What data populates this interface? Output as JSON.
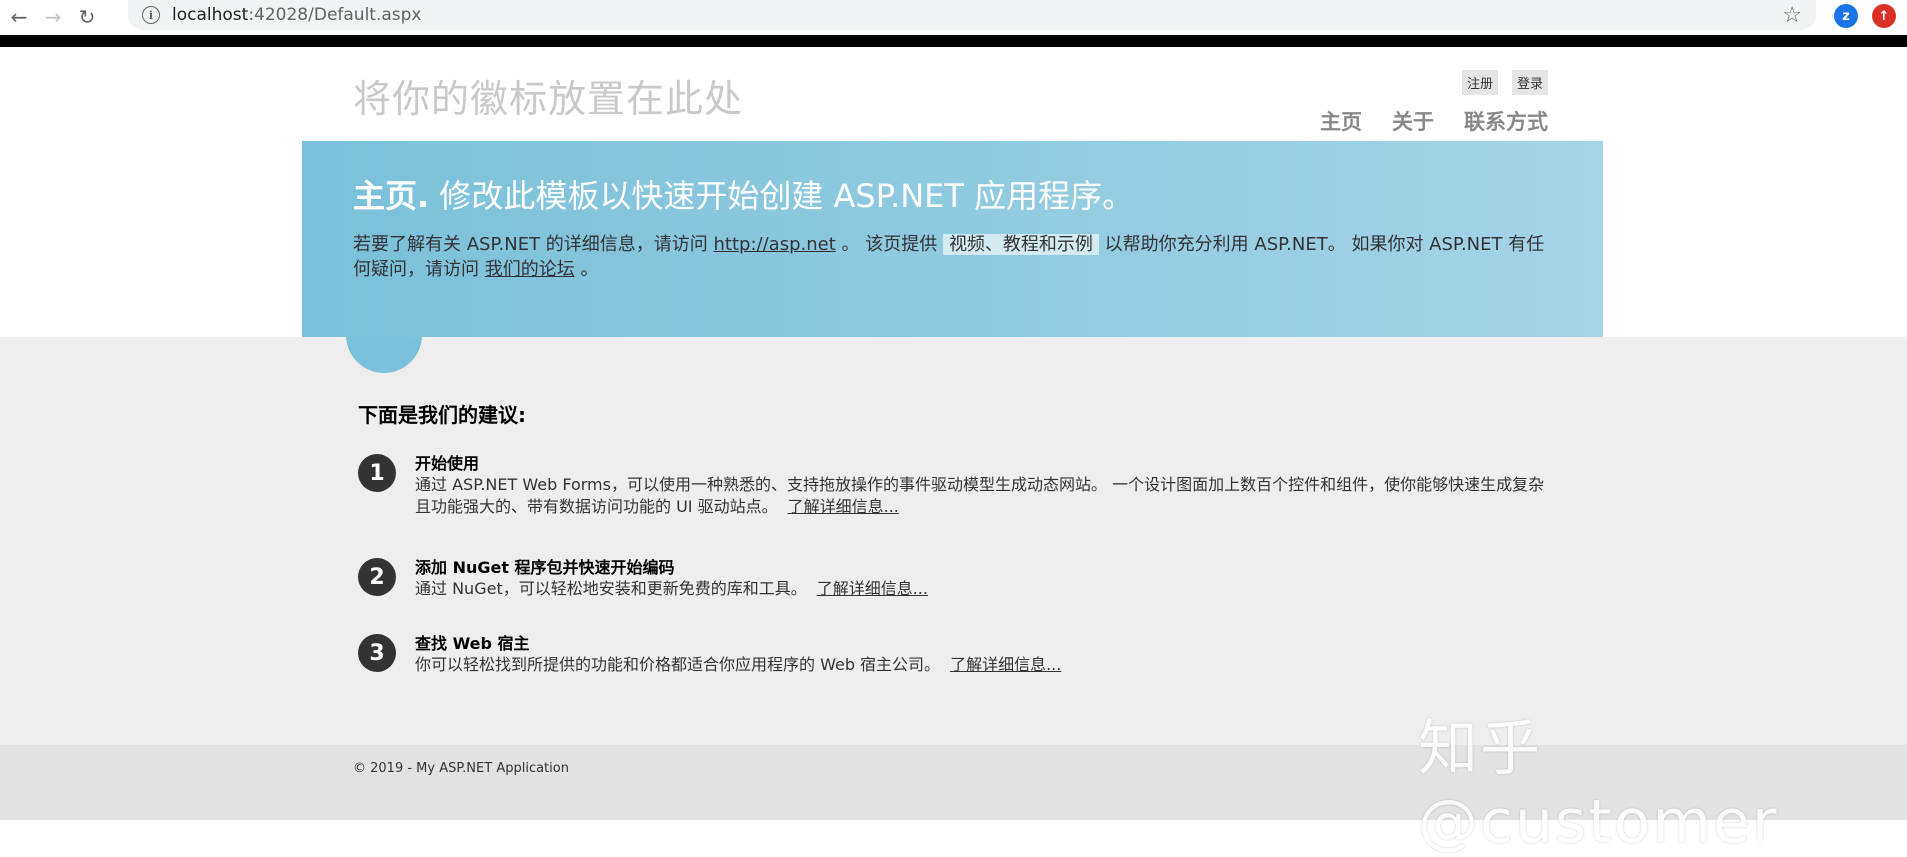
{
  "browser": {
    "back_icon": "arrow-left",
    "forward_icon": "arrow-right",
    "reload_icon": "reload",
    "url_host": "localhost",
    "url_rest": ":42028/Default.aspx",
    "ext1_label": "z",
    "ext2_label": "↑",
    "colors": {
      "ext1": "#1a73e8",
      "ext2": "#d93025"
    }
  },
  "header": {
    "site_title": "将你的徽标放置在此处",
    "register_label": "注册",
    "login_label": "登录",
    "menu": [
      "主页",
      "关于",
      "联系方式"
    ]
  },
  "featured": {
    "heading_strong": "主页.",
    "heading_rest": " 修改此模板以快速开始创建 ASP.NET 应用程序。",
    "text_1": "若要了解有关 ASP.NET 的详细信息，请访问 ",
    "link_1": "http://asp.net",
    "text_2": " 。 该页提供 ",
    "link_2": "视频、教程和示例",
    "text_3": " 以帮助你充分利用 ASP.NET。 如果你对 ASP.NET 有任何疑问，请访问 ",
    "link_3": "我们的论坛",
    "text_4": " 。"
  },
  "body": {
    "recommend_title": "下面是我们的建议:",
    "items": [
      {
        "num": "1",
        "title": "开始使用",
        "text": "通过 ASP.NET Web Forms，可以使用一种熟悉的、支持拖放操作的事件驱动模型生成动态网站。 一个设计图面加上数百个控件和组件，使你能够快速生成复杂且功能强大的、带有数据访问功能的 UI 驱动站点。",
        "link": "了解详细信息..."
      },
      {
        "num": "2",
        "title": "添加 NuGet 程序包并快速开始编码",
        "text": "通过 NuGet，可以轻松地安装和更新免费的库和工具。",
        "link": "了解详细信息..."
      },
      {
        "num": "3",
        "title": "查找 Web 宿主",
        "text": "你可以轻松找到所提供的功能和价格都适合你应用程序的 Web 宿主公司。",
        "link": "了解详细信息..."
      }
    ]
  },
  "footer": {
    "copyright": "© 2019 - My ASP.NET Application"
  },
  "watermark": "知乎 @customer"
}
